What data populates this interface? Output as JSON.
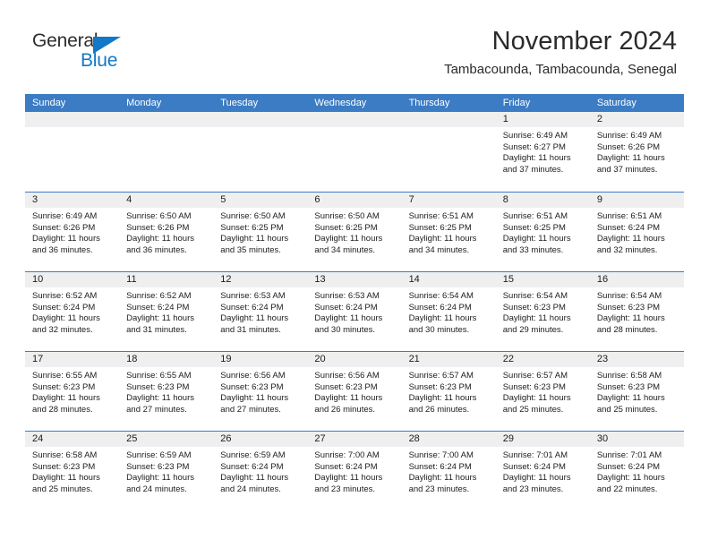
{
  "brand": {
    "name_top": "General",
    "name_bottom": "Blue",
    "accent_color": "#1278c8",
    "triangle_icon": "triangle-icon"
  },
  "header": {
    "title": "November 2024",
    "subtitle": "Tambacounda, Tambacounda, Senegal"
  },
  "theme": {
    "header_blue": "#3b7cc4",
    "day_band_gray": "#efefef",
    "text_color": "#1c1c1c"
  },
  "calendar": {
    "weekday_headers": [
      "Sunday",
      "Monday",
      "Tuesday",
      "Wednesday",
      "Thursday",
      "Friday",
      "Saturday"
    ],
    "weeks": [
      [
        {
          "day": "",
          "empty": true,
          "sunrise": "",
          "sunset": "",
          "daylight_line1": "",
          "daylight_line2": ""
        },
        {
          "day": "",
          "empty": true,
          "sunrise": "",
          "sunset": "",
          "daylight_line1": "",
          "daylight_line2": ""
        },
        {
          "day": "",
          "empty": true,
          "sunrise": "",
          "sunset": "",
          "daylight_line1": "",
          "daylight_line2": ""
        },
        {
          "day": "",
          "empty": true,
          "sunrise": "",
          "sunset": "",
          "daylight_line1": "",
          "daylight_line2": ""
        },
        {
          "day": "",
          "empty": true,
          "sunrise": "",
          "sunset": "",
          "daylight_line1": "",
          "daylight_line2": ""
        },
        {
          "day": "1",
          "empty": false,
          "sunrise": "Sunrise: 6:49 AM",
          "sunset": "Sunset: 6:27 PM",
          "daylight_line1": "Daylight: 11 hours",
          "daylight_line2": "and 37 minutes."
        },
        {
          "day": "2",
          "empty": false,
          "sunrise": "Sunrise: 6:49 AM",
          "sunset": "Sunset: 6:26 PM",
          "daylight_line1": "Daylight: 11 hours",
          "daylight_line2": "and 37 minutes."
        }
      ],
      [
        {
          "day": "3",
          "empty": false,
          "sunrise": "Sunrise: 6:49 AM",
          "sunset": "Sunset: 6:26 PM",
          "daylight_line1": "Daylight: 11 hours",
          "daylight_line2": "and 36 minutes."
        },
        {
          "day": "4",
          "empty": false,
          "sunrise": "Sunrise: 6:50 AM",
          "sunset": "Sunset: 6:26 PM",
          "daylight_line1": "Daylight: 11 hours",
          "daylight_line2": "and 36 minutes."
        },
        {
          "day": "5",
          "empty": false,
          "sunrise": "Sunrise: 6:50 AM",
          "sunset": "Sunset: 6:25 PM",
          "daylight_line1": "Daylight: 11 hours",
          "daylight_line2": "and 35 minutes."
        },
        {
          "day": "6",
          "empty": false,
          "sunrise": "Sunrise: 6:50 AM",
          "sunset": "Sunset: 6:25 PM",
          "daylight_line1": "Daylight: 11 hours",
          "daylight_line2": "and 34 minutes."
        },
        {
          "day": "7",
          "empty": false,
          "sunrise": "Sunrise: 6:51 AM",
          "sunset": "Sunset: 6:25 PM",
          "daylight_line1": "Daylight: 11 hours",
          "daylight_line2": "and 34 minutes."
        },
        {
          "day": "8",
          "empty": false,
          "sunrise": "Sunrise: 6:51 AM",
          "sunset": "Sunset: 6:25 PM",
          "daylight_line1": "Daylight: 11 hours",
          "daylight_line2": "and 33 minutes."
        },
        {
          "day": "9",
          "empty": false,
          "sunrise": "Sunrise: 6:51 AM",
          "sunset": "Sunset: 6:24 PM",
          "daylight_line1": "Daylight: 11 hours",
          "daylight_line2": "and 32 minutes."
        }
      ],
      [
        {
          "day": "10",
          "empty": false,
          "sunrise": "Sunrise: 6:52 AM",
          "sunset": "Sunset: 6:24 PM",
          "daylight_line1": "Daylight: 11 hours",
          "daylight_line2": "and 32 minutes."
        },
        {
          "day": "11",
          "empty": false,
          "sunrise": "Sunrise: 6:52 AM",
          "sunset": "Sunset: 6:24 PM",
          "daylight_line1": "Daylight: 11 hours",
          "daylight_line2": "and 31 minutes."
        },
        {
          "day": "12",
          "empty": false,
          "sunrise": "Sunrise: 6:53 AM",
          "sunset": "Sunset: 6:24 PM",
          "daylight_line1": "Daylight: 11 hours",
          "daylight_line2": "and 31 minutes."
        },
        {
          "day": "13",
          "empty": false,
          "sunrise": "Sunrise: 6:53 AM",
          "sunset": "Sunset: 6:24 PM",
          "daylight_line1": "Daylight: 11 hours",
          "daylight_line2": "and 30 minutes."
        },
        {
          "day": "14",
          "empty": false,
          "sunrise": "Sunrise: 6:54 AM",
          "sunset": "Sunset: 6:24 PM",
          "daylight_line1": "Daylight: 11 hours",
          "daylight_line2": "and 30 minutes."
        },
        {
          "day": "15",
          "empty": false,
          "sunrise": "Sunrise: 6:54 AM",
          "sunset": "Sunset: 6:23 PM",
          "daylight_line1": "Daylight: 11 hours",
          "daylight_line2": "and 29 minutes."
        },
        {
          "day": "16",
          "empty": false,
          "sunrise": "Sunrise: 6:54 AM",
          "sunset": "Sunset: 6:23 PM",
          "daylight_line1": "Daylight: 11 hours",
          "daylight_line2": "and 28 minutes."
        }
      ],
      [
        {
          "day": "17",
          "empty": false,
          "sunrise": "Sunrise: 6:55 AM",
          "sunset": "Sunset: 6:23 PM",
          "daylight_line1": "Daylight: 11 hours",
          "daylight_line2": "and 28 minutes."
        },
        {
          "day": "18",
          "empty": false,
          "sunrise": "Sunrise: 6:55 AM",
          "sunset": "Sunset: 6:23 PM",
          "daylight_line1": "Daylight: 11 hours",
          "daylight_line2": "and 27 minutes."
        },
        {
          "day": "19",
          "empty": false,
          "sunrise": "Sunrise: 6:56 AM",
          "sunset": "Sunset: 6:23 PM",
          "daylight_line1": "Daylight: 11 hours",
          "daylight_line2": "and 27 minutes."
        },
        {
          "day": "20",
          "empty": false,
          "sunrise": "Sunrise: 6:56 AM",
          "sunset": "Sunset: 6:23 PM",
          "daylight_line1": "Daylight: 11 hours",
          "daylight_line2": "and 26 minutes."
        },
        {
          "day": "21",
          "empty": false,
          "sunrise": "Sunrise: 6:57 AM",
          "sunset": "Sunset: 6:23 PM",
          "daylight_line1": "Daylight: 11 hours",
          "daylight_line2": "and 26 minutes."
        },
        {
          "day": "22",
          "empty": false,
          "sunrise": "Sunrise: 6:57 AM",
          "sunset": "Sunset: 6:23 PM",
          "daylight_line1": "Daylight: 11 hours",
          "daylight_line2": "and 25 minutes."
        },
        {
          "day": "23",
          "empty": false,
          "sunrise": "Sunrise: 6:58 AM",
          "sunset": "Sunset: 6:23 PM",
          "daylight_line1": "Daylight: 11 hours",
          "daylight_line2": "and 25 minutes."
        }
      ],
      [
        {
          "day": "24",
          "empty": false,
          "sunrise": "Sunrise: 6:58 AM",
          "sunset": "Sunset: 6:23 PM",
          "daylight_line1": "Daylight: 11 hours",
          "daylight_line2": "and 25 minutes."
        },
        {
          "day": "25",
          "empty": false,
          "sunrise": "Sunrise: 6:59 AM",
          "sunset": "Sunset: 6:23 PM",
          "daylight_line1": "Daylight: 11 hours",
          "daylight_line2": "and 24 minutes."
        },
        {
          "day": "26",
          "empty": false,
          "sunrise": "Sunrise: 6:59 AM",
          "sunset": "Sunset: 6:24 PM",
          "daylight_line1": "Daylight: 11 hours",
          "daylight_line2": "and 24 minutes."
        },
        {
          "day": "27",
          "empty": false,
          "sunrise": "Sunrise: 7:00 AM",
          "sunset": "Sunset: 6:24 PM",
          "daylight_line1": "Daylight: 11 hours",
          "daylight_line2": "and 23 minutes."
        },
        {
          "day": "28",
          "empty": false,
          "sunrise": "Sunrise: 7:00 AM",
          "sunset": "Sunset: 6:24 PM",
          "daylight_line1": "Daylight: 11 hours",
          "daylight_line2": "and 23 minutes."
        },
        {
          "day": "29",
          "empty": false,
          "sunrise": "Sunrise: 7:01 AM",
          "sunset": "Sunset: 6:24 PM",
          "daylight_line1": "Daylight: 11 hours",
          "daylight_line2": "and 23 minutes."
        },
        {
          "day": "30",
          "empty": false,
          "sunrise": "Sunrise: 7:01 AM",
          "sunset": "Sunset: 6:24 PM",
          "daylight_line1": "Daylight: 11 hours",
          "daylight_line2": "and 22 minutes."
        }
      ]
    ]
  }
}
